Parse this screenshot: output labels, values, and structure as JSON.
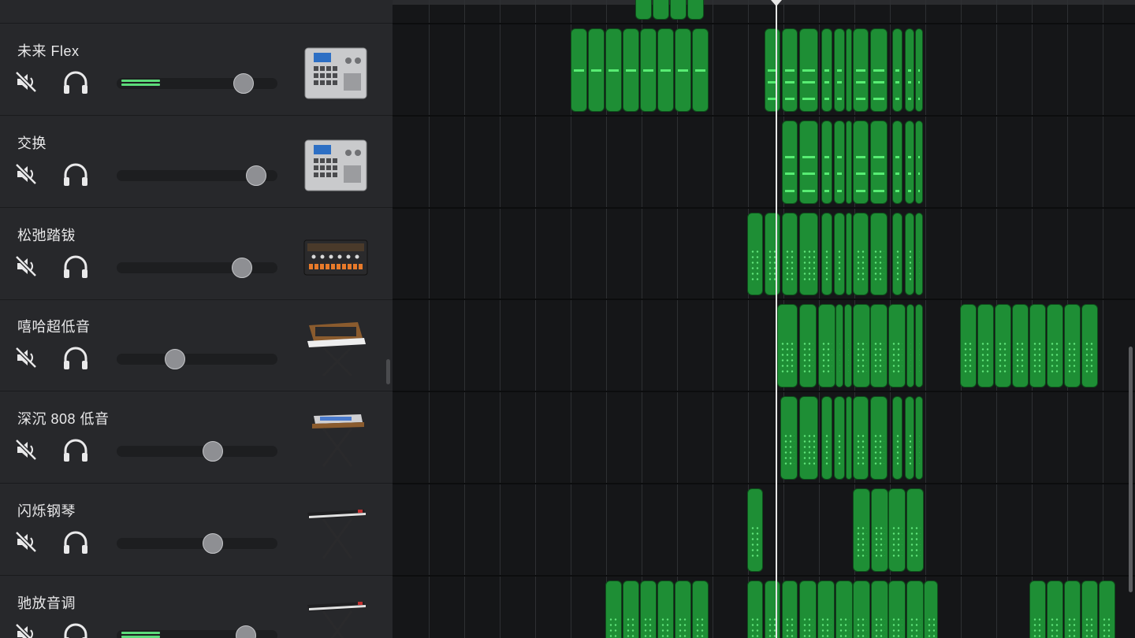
{
  "tracks": [
    {
      "name": "未来 Flex",
      "volume": 0.84,
      "meter": 0.24,
      "instrument": "drum-machine-icon"
    },
    {
      "name": "交换",
      "volume": 0.93,
      "meter": 0,
      "instrument": "drum-machine-icon"
    },
    {
      "name": "松弛踏钹",
      "volume": 0.83,
      "meter": 0,
      "instrument": "beat-machine-icon"
    },
    {
      "name": "嘻哈超低音",
      "volume": 0.37,
      "meter": 0,
      "instrument": "synth-keyboard-icon"
    },
    {
      "name": "深沉 808 低音",
      "volume": 0.63,
      "meter": 0,
      "instrument": "keyboard-stand-icon"
    },
    {
      "name": "闪烁钢琴",
      "volume": 0.63,
      "meter": 0,
      "instrument": "piano-keyboard-icon"
    },
    {
      "name": "驰放音调",
      "volume": 0.86,
      "meter": 0.24,
      "instrument": "piano-keyboard-icon"
    }
  ],
  "icons": {
    "mute": "speaker-mute-icon",
    "solo": "headphones-icon"
  },
  "colors": {
    "region": "#1e8e35",
    "region_notes": "#58ec73",
    "meter": "#5cdb7a",
    "panel": "#27282b",
    "timeline": "#151618"
  }
}
